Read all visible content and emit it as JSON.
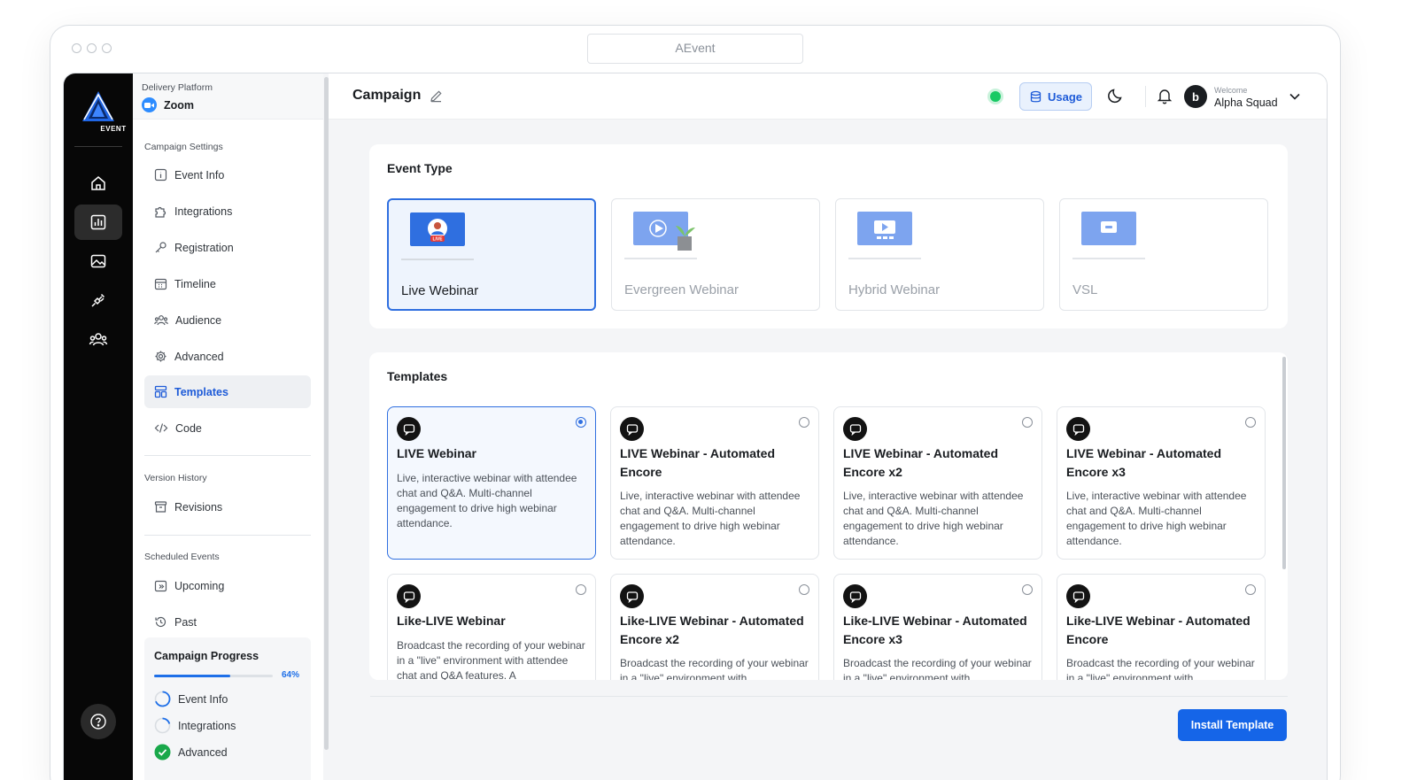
{
  "browser": {
    "url_title": "AEvent"
  },
  "rail": {
    "logo_text": "EVENT"
  },
  "sidebar": {
    "delivery_label": "Delivery Platform",
    "platform": "Zoom",
    "campaign_settings_label": "Campaign Settings",
    "settings_items": [
      {
        "label": "Event Info",
        "icon": "info-icon"
      },
      {
        "label": "Integrations",
        "icon": "puzzle-icon"
      },
      {
        "label": "Registration",
        "icon": "key-icon"
      },
      {
        "label": "Timeline",
        "icon": "calendar-icon"
      },
      {
        "label": "Audience",
        "icon": "users-icon"
      },
      {
        "label": "Advanced",
        "icon": "gear-icon"
      },
      {
        "label": "Templates",
        "icon": "layout-icon",
        "active": true
      },
      {
        "label": "Code",
        "icon": "code-icon"
      }
    ],
    "version_history_label": "Version History",
    "revisions_label": "Revisions",
    "scheduled_events_label": "Scheduled Events",
    "upcoming_label": "Upcoming",
    "past_label": "Past",
    "progress": {
      "title": "Campaign Progress",
      "percent": 64,
      "percent_label": "64%",
      "items": [
        {
          "label": "Event Info",
          "state": "in-progress"
        },
        {
          "label": "Integrations",
          "state": "in-progress"
        },
        {
          "label": "Advanced",
          "state": "done"
        }
      ]
    }
  },
  "header": {
    "title": "Campaign",
    "usage_label": "Usage",
    "welcome": "Welcome",
    "user_name": "Alpha Squad",
    "avatar_letter": "b",
    "status_color": "#18c964"
  },
  "event_type": {
    "title": "Event Type",
    "options": [
      {
        "label": "Live Webinar",
        "selected": true
      },
      {
        "label": "Evergreen Webinar",
        "selected": false
      },
      {
        "label": "Hybrid Webinar",
        "selected": false
      },
      {
        "label": "VSL",
        "selected": false
      }
    ]
  },
  "templates": {
    "title": "Templates",
    "items": [
      {
        "title": "LIVE Webinar",
        "desc": "Live, interactive webinar with attendee chat and Q&A. Multi-channel engagement to drive high webinar attendance.",
        "selected": true
      },
      {
        "title": "LIVE Webinar - Automated Encore",
        "desc": "Live, interactive webinar with attendee chat and Q&A. Multi-channel engagement to drive high webinar attendance.",
        "selected": false
      },
      {
        "title": "LIVE Webinar - Automated Encore x2",
        "desc": "Live, interactive webinar with attendee chat and Q&A. Multi-channel engagement to drive high webinar attendance.",
        "selected": false
      },
      {
        "title": "LIVE Webinar - Automated Encore x3",
        "desc": "Live, interactive webinar with attendee chat and Q&A. Multi-channel engagement to drive high webinar attendance.",
        "selected": false
      },
      {
        "title": "Like-LIVE Webinar",
        "desc": "Broadcast the recording of your webinar in a \"live\" environment with attendee chat and Q&A features. A",
        "selected": false
      },
      {
        "title": "Like-LIVE Webinar - Automated Encore x2",
        "desc": "Broadcast the recording of your webinar in a \"live\" environment with",
        "selected": false
      },
      {
        "title": "Like-LIVE Webinar - Automated Encore x3",
        "desc": "Broadcast the recording of your webinar in a \"live\" environment with",
        "selected": false
      },
      {
        "title": "Like-LIVE Webinar - Automated Encore",
        "desc": "Broadcast the recording of your webinar in a \"live\" environment with",
        "selected": false
      }
    ],
    "install_label": "Install Template"
  },
  "colors": {
    "accent": "#1565e8",
    "selected_border": "#2f6fe0",
    "rail_bg": "#070707"
  }
}
